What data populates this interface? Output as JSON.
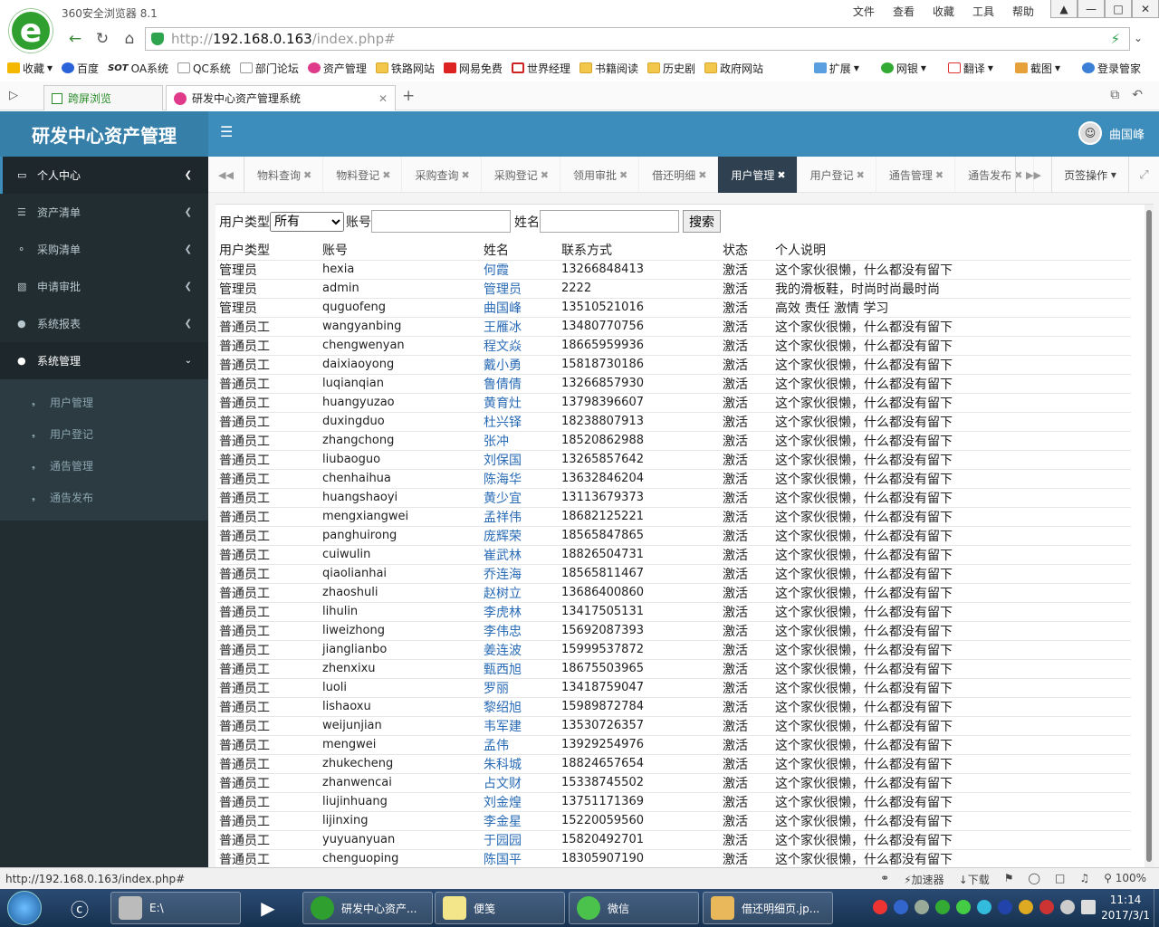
{
  "browser": {
    "name": "360安全浏览器 8.1",
    "menus": [
      "文件",
      "查看",
      "收藏",
      "工具",
      "帮助"
    ],
    "url_prefix": "http://",
    "url_host": "192.168.0.163",
    "url_path": "/index.php#",
    "bookmarks": [
      "收藏",
      "百度",
      "OA系统",
      "QC系统",
      "部门论坛",
      "资产管理",
      "铁路网站",
      "网易免费",
      "世界经理",
      "书籍阅读",
      "历史剧",
      "政府网站"
    ],
    "bookmark_tools": [
      "扩展",
      "网银",
      "翻译",
      "截图",
      "登录管家"
    ],
    "tab_side": "跨屏浏览",
    "tab_title": "研发中心资产管理系统"
  },
  "app": {
    "logo": "研发中心资产管理",
    "user_name": "曲国峰"
  },
  "sidebar": {
    "menus": [
      "个人中心",
      "资产清单",
      "采购清单",
      "申请审批",
      "系统报表",
      "系统管理"
    ],
    "submenu": [
      "用户管理",
      "用户登记",
      "通告管理",
      "通告发布"
    ]
  },
  "content_tabs": [
    "物料查询",
    "物料登记",
    "采购查询",
    "采购登记",
    "领用审批",
    "借还明细",
    "用户管理",
    "用户登记",
    "通告管理",
    "通告发布"
  ],
  "active_tab": "用户管理",
  "tab_ops": "页签操作",
  "filter": {
    "user_type_label": "用户类型",
    "user_type_selected": "所有",
    "account_label": "账号",
    "name_label": "姓名",
    "search_button": "搜索"
  },
  "table": {
    "headers": [
      "用户类型",
      "账号",
      "姓名",
      "联系方式",
      "状态",
      "个人说明"
    ],
    "rows": [
      [
        "管理员",
        "hexia",
        "何霞",
        "13266848413",
        "激活",
        "这个家伙很懒，什么都没有留下"
      ],
      [
        "管理员",
        "admin",
        "管理员",
        "2222",
        "激活",
        "我的滑板鞋，时尚时尚最时尚"
      ],
      [
        "管理员",
        "quguofeng",
        "曲国峰",
        "13510521016",
        "激活",
        "高效 责任 激情 学习"
      ],
      [
        "普通员工",
        "wangyanbing",
        "王雁冰",
        "13480770756",
        "激活",
        "这个家伙很懒，什么都没有留下"
      ],
      [
        "普通员工",
        "chengwenyan",
        "程文焱",
        "18665959936",
        "激活",
        "这个家伙很懒，什么都没有留下"
      ],
      [
        "普通员工",
        "daixiaoyong",
        "戴小勇",
        "15818730186",
        "激活",
        "这个家伙很懒，什么都没有留下"
      ],
      [
        "普通员工",
        "luqianqian",
        "鲁倩倩",
        "13266857930",
        "激活",
        "这个家伙很懒，什么都没有留下"
      ],
      [
        "普通员工",
        "huangyuzao",
        "黄育灶",
        "13798396607",
        "激活",
        "这个家伙很懒，什么都没有留下"
      ],
      [
        "普通员工",
        "duxingduo",
        "杜兴铎",
        "18238807913",
        "激活",
        "这个家伙很懒，什么都没有留下"
      ],
      [
        "普通员工",
        "zhangchong",
        "张冲",
        "18520862988",
        "激活",
        "这个家伙很懒，什么都没有留下"
      ],
      [
        "普通员工",
        "liubaoguo",
        "刘保国",
        "13265857642",
        "激活",
        "这个家伙很懒，什么都没有留下"
      ],
      [
        "普通员工",
        "chenhaihua",
        "陈海华",
        "13632846204",
        "激活",
        "这个家伙很懒，什么都没有留下"
      ],
      [
        "普通员工",
        "huangshaoyi",
        "黄少宜",
        "13113679373",
        "激活",
        "这个家伙很懒，什么都没有留下"
      ],
      [
        "普通员工",
        "mengxiangwei",
        "孟祥伟",
        "18682125221",
        "激活",
        "这个家伙很懒，什么都没有留下"
      ],
      [
        "普通员工",
        "panghuirong",
        "庞辉荣",
        "18565847865",
        "激活",
        "这个家伙很懒，什么都没有留下"
      ],
      [
        "普通员工",
        "cuiwulin",
        "崔武林",
        "18826504731",
        "激活",
        "这个家伙很懒，什么都没有留下"
      ],
      [
        "普通员工",
        "qiaolianhai",
        "乔连海",
        "18565811467",
        "激活",
        "这个家伙很懒，什么都没有留下"
      ],
      [
        "普通员工",
        "zhaoshuli",
        "赵树立",
        "13686400860",
        "激活",
        "这个家伙很懒，什么都没有留下"
      ],
      [
        "普通员工",
        "lihulin",
        "李虎林",
        "13417505131",
        "激活",
        "这个家伙很懒，什么都没有留下"
      ],
      [
        "普通员工",
        "liweizhong",
        "李伟忠",
        "15692087393",
        "激活",
        "这个家伙很懒，什么都没有留下"
      ],
      [
        "普通员工",
        "jianglianbo",
        "姜连波",
        "15999537872",
        "激活",
        "这个家伙很懒，什么都没有留下"
      ],
      [
        "普通员工",
        "zhenxixu",
        "甄西旭",
        "18675503965",
        "激活",
        "这个家伙很懒，什么都没有留下"
      ],
      [
        "普通员工",
        "luoli",
        "罗丽",
        "13418759047",
        "激活",
        "这个家伙很懒，什么都没有留下"
      ],
      [
        "普通员工",
        "lishaoxu",
        "黎绍旭",
        "15989872784",
        "激活",
        "这个家伙很懒，什么都没有留下"
      ],
      [
        "普通员工",
        "weijunjian",
        "韦军建",
        "13530726357",
        "激活",
        "这个家伙很懒，什么都没有留下"
      ],
      [
        "普通员工",
        "mengwei",
        "孟伟",
        "13929254976",
        "激活",
        "这个家伙很懒，什么都没有留下"
      ],
      [
        "普通员工",
        "zhukecheng",
        "朱科城",
        "18824657654",
        "激活",
        "这个家伙很懒，什么都没有留下"
      ],
      [
        "普通员工",
        "zhanwencai",
        "占文财",
        "15338745502",
        "激活",
        "这个家伙很懒，什么都没有留下"
      ],
      [
        "普通员工",
        "liujinhuang",
        "刘金煌",
        "13751171369",
        "激活",
        "这个家伙很懒，什么都没有留下"
      ],
      [
        "普通员工",
        "lijinxing",
        "李金星",
        "15220059560",
        "激活",
        "这个家伙很懒，什么都没有留下"
      ],
      [
        "普通员工",
        "yuyuanyuan",
        "于园园",
        "15820492701",
        "激活",
        "这个家伙很懒，什么都没有留下"
      ],
      [
        "普通员工",
        "chenguoping",
        "陈国平",
        "18305907190",
        "激活",
        "这个家伙很懒，什么都没有留下"
      ]
    ]
  },
  "statusbar": {
    "url": "http://192.168.0.163/index.php#",
    "tools": [
      "加速器",
      "下载",
      "100%"
    ]
  },
  "taskbar": {
    "tasks": [
      "E:\\",
      "研发中心资产...",
      "便笺",
      "微信",
      "借还明细页.jp..."
    ],
    "time": "11:14",
    "date": "2017/3/1"
  }
}
